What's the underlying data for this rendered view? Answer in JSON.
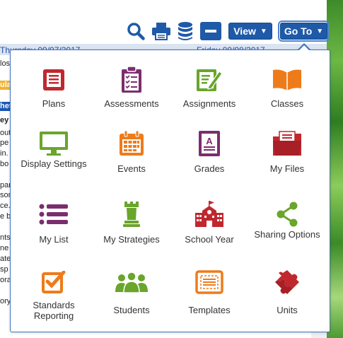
{
  "toolbar": {
    "search_icon": "search-icon",
    "print_icon": "printer-icon",
    "database_icon": "database-icon",
    "collapse_icon": "minus-icon",
    "view_label": "View",
    "goto_label": "Go To"
  },
  "calendar": {
    "day1": "Thursday 09/07/2017",
    "day2": "Friday 09/08/2017",
    "left_fragments": [
      "los",
      "ula",
      "het",
      "ey",
      "out",
      "pe",
      "in.",
      "bo",
      "par",
      "son",
      "ce.",
      "e b",
      "nts",
      "ne",
      "ate",
      "sp",
      "ora",
      "ory"
    ]
  },
  "menu": {
    "items": [
      {
        "label": "Plans",
        "icon": "plans-icon",
        "color": "#c0282e"
      },
      {
        "label": "Assessments",
        "icon": "clipboard-icon",
        "color": "#7b2d6e"
      },
      {
        "label": "Assignments",
        "icon": "assignment-edit-icon",
        "color": "#6aa52c"
      },
      {
        "label": "Classes",
        "icon": "open-book-icon",
        "color": "#ee7b1a"
      },
      {
        "label": "Display Settings",
        "icon": "monitor-icon",
        "color": "#6aa52c"
      },
      {
        "label": "Events",
        "icon": "calendar-icon",
        "color": "#ee7b1a"
      },
      {
        "label": "Grades",
        "icon": "grade-document-icon",
        "color": "#7b2d6e"
      },
      {
        "label": "My Files",
        "icon": "folder-icon",
        "color": "#c0282e"
      },
      {
        "label": "My List",
        "icon": "list-icon",
        "color": "#7b2d6e"
      },
      {
        "label": "My Strategies",
        "icon": "chess-rook-icon",
        "color": "#6aa52c"
      },
      {
        "label": "School Year",
        "icon": "school-building-icon",
        "color": "#c0282e"
      },
      {
        "label": "Sharing Options",
        "icon": "share-icon",
        "color": "#6aa52c"
      },
      {
        "label": "Standards Reporting",
        "icon": "checkbox-icon",
        "color": "#ee7b1a"
      },
      {
        "label": "Students",
        "icon": "users-icon",
        "color": "#6aa52c"
      },
      {
        "label": "Templates",
        "icon": "template-icon",
        "color": "#ee7b1a"
      },
      {
        "label": "Units",
        "icon": "puzzle-icon",
        "color": "#c0282e"
      }
    ]
  },
  "colors": {
    "brand_blue": "#1f5aa8",
    "icon_blue": "#1f5aa8",
    "panel_border": "#3e74c1"
  }
}
